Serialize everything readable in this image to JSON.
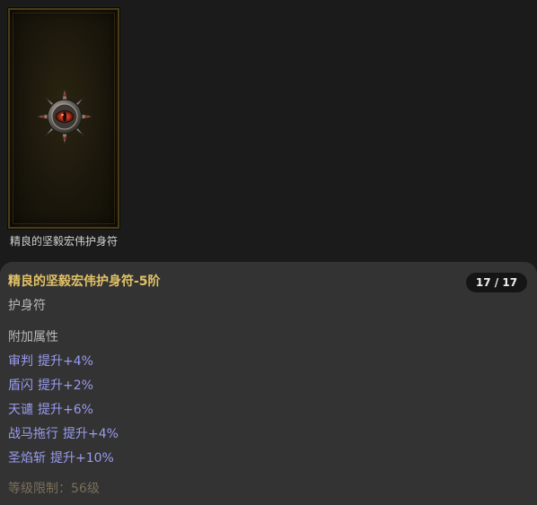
{
  "item_card": {
    "caption": "精良的坚毅宏伟护身符",
    "icon": "amulet-icon"
  },
  "tooltip": {
    "title": "精良的坚毅宏伟护身符-5阶",
    "count": "17 / 17",
    "type": "护身符",
    "attributes_header": "附加属性",
    "attributes": [
      {
        "name": "审判",
        "value": "提升+4%"
      },
      {
        "name": "盾闪",
        "value": "提升+2%"
      },
      {
        "name": "天谴",
        "value": "提升+6%"
      },
      {
        "name": "战马拖行",
        "value": "提升+4%"
      },
      {
        "name": "圣焰斩",
        "value": "提升+10%"
      }
    ],
    "level_requirement": "等级限制：56级"
  },
  "colors": {
    "background": "#1b1b1b",
    "panel": "#333333",
    "title_gold": "#e2c266",
    "attribute_blue": "#9a9cf0",
    "muted_gray": "#b7b7b7",
    "level_brown": "#7a6f5a"
  }
}
